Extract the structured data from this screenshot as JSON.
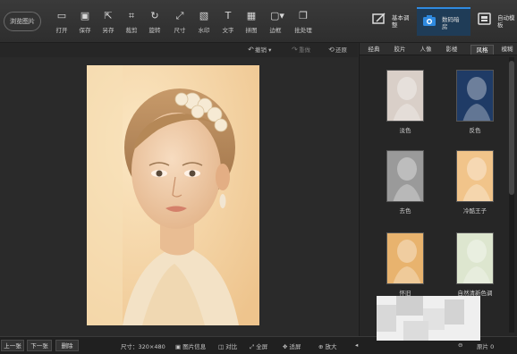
{
  "toolbar": {
    "browse_label": "浏览图片",
    "tools": [
      {
        "label": "打开",
        "icon": "open-folder-icon",
        "glyph": "▭"
      },
      {
        "label": "保存",
        "icon": "save-icon",
        "glyph": "▣"
      },
      {
        "label": "另存",
        "icon": "save-as-icon",
        "glyph": "⇱"
      },
      {
        "label": "裁剪",
        "icon": "crop-icon",
        "glyph": "⌗"
      },
      {
        "label": "旋转",
        "icon": "rotate-icon",
        "glyph": "↻"
      },
      {
        "label": "尺寸",
        "icon": "resize-icon",
        "glyph": "⤢"
      },
      {
        "label": "水印",
        "icon": "watermark-icon",
        "glyph": "▧"
      },
      {
        "label": "文字",
        "icon": "text-icon",
        "glyph": "T"
      },
      {
        "label": "拼图",
        "icon": "collage-icon",
        "glyph": "▦"
      },
      {
        "label": "边框",
        "icon": "border-icon",
        "glyph": "▢▾"
      },
      {
        "label": "批处理",
        "icon": "batch-icon",
        "glyph": "❐"
      }
    ],
    "modes": [
      {
        "label": "基本调整",
        "icon": "basic-adjust-icon"
      },
      {
        "label": "数码暗房",
        "icon": "camera-icon"
      },
      {
        "label": "自动模板",
        "icon": "template-icon"
      }
    ]
  },
  "subbar": {
    "undo_label": "撤销",
    "redo_label": "重做",
    "restore_label": "还原"
  },
  "filter_panel": {
    "tabs": [
      "经典",
      "胶片",
      "人像",
      "影楼",
      "风格",
      "模糊"
    ],
    "active_tab": "风格",
    "filters": [
      {
        "label": "淡色",
        "tone": "#d9cfc8"
      },
      {
        "label": "反色",
        "tone": "#1f3b66"
      },
      {
        "label": "去色",
        "tone": "#9a9a9a"
      },
      {
        "label": "冷酷王子",
        "tone": "#f1c48a"
      },
      {
        "label": "怀旧",
        "tone": "#e8b36e"
      },
      {
        "label": "自然清新色调",
        "tone": "#dde6cf"
      }
    ]
  },
  "bottombar": {
    "prev_label": "上一张",
    "next_label": "下一张",
    "delete_label": "删除",
    "size_text": "尺寸：320×480",
    "info_label": "图片信息",
    "compare_label": "对比",
    "fullscreen_label": "全屏",
    "fit_label": "适屏",
    "zoom_in_label": "放大",
    "zoom_text": "原片 0"
  },
  "colors": {
    "accent": "#2f8ae0",
    "active_mode_bg": "#1f3c57",
    "photo_tone": "#f2d3a0"
  }
}
